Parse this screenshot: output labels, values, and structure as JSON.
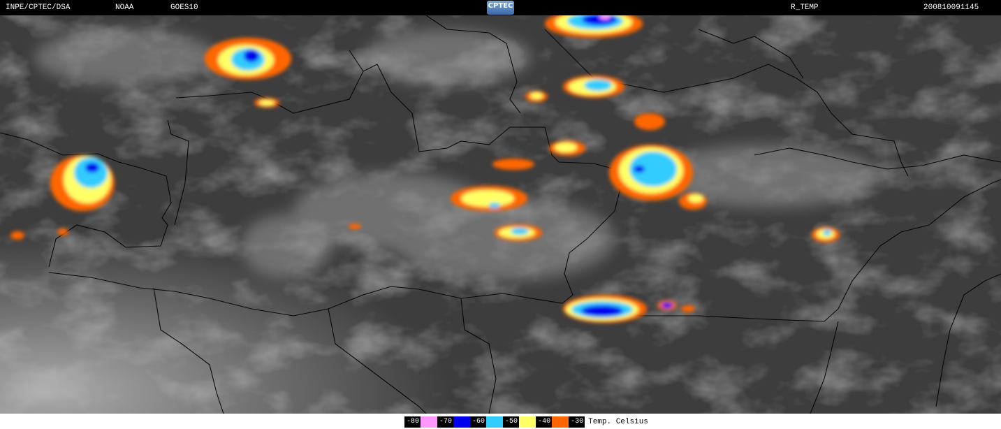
{
  "header": {
    "source": "INPE/CPTEC/DSA",
    "agency": "NOAA",
    "satellite": "GOES10",
    "logo_text": "CPTEC",
    "product": "R_TEMP",
    "timestamp": "200810091145"
  },
  "legend": {
    "title": "Temp. Celsius",
    "items": [
      {
        "label": "-80",
        "color": "#ff99ff"
      },
      {
        "label": "-70",
        "color": "#0000ee"
      },
      {
        "label": "-60",
        "color": "#33ccff"
      },
      {
        "label": "-50",
        "color": "#ffff66"
      },
      {
        "label": "-40",
        "color": "#ff6600"
      },
      {
        "label": "-30",
        "color": "#000000"
      }
    ]
  },
  "colors": {
    "background_gray": "#3c3c3c",
    "cold_cloud": "#ff6600"
  }
}
